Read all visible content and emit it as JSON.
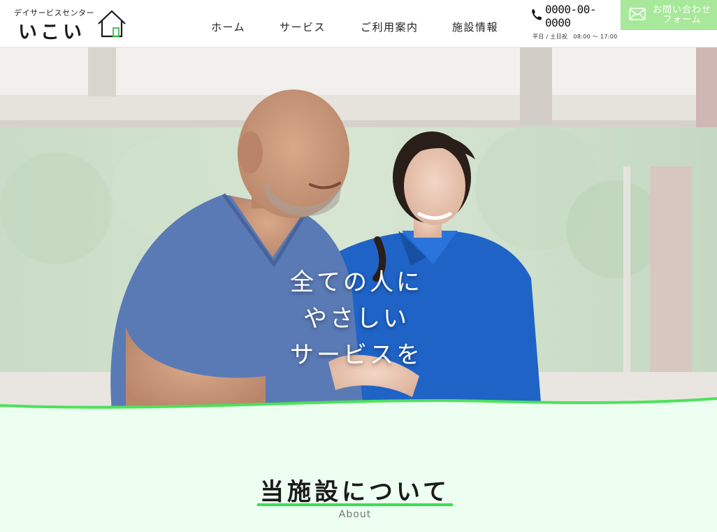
{
  "header": {
    "logo_sub": "デイサービスセンター",
    "logo_main": "いこい",
    "nav": [
      {
        "label": "ホーム"
      },
      {
        "label": "サービス"
      },
      {
        "label": "ご利用案内"
      },
      {
        "label": "施設情報"
      }
    ],
    "phone_number": "0000-00-0000",
    "phone_hours": "平日 / 土日祝　08:00 ～ 17:00",
    "contact_line1": "お問い合わせ",
    "contact_line2": "フォーム"
  },
  "hero": {
    "copy": [
      "全ての人に",
      "やさしい",
      "サービスを"
    ]
  },
  "about": {
    "title": "当施設について",
    "subtitle": "About"
  },
  "colors": {
    "accent_green": "#38e04f",
    "contact_button": "#a8e89a",
    "section_bg": "#edfff1"
  },
  "icons": [
    "house-icon",
    "phone-icon",
    "mail-icon"
  ]
}
